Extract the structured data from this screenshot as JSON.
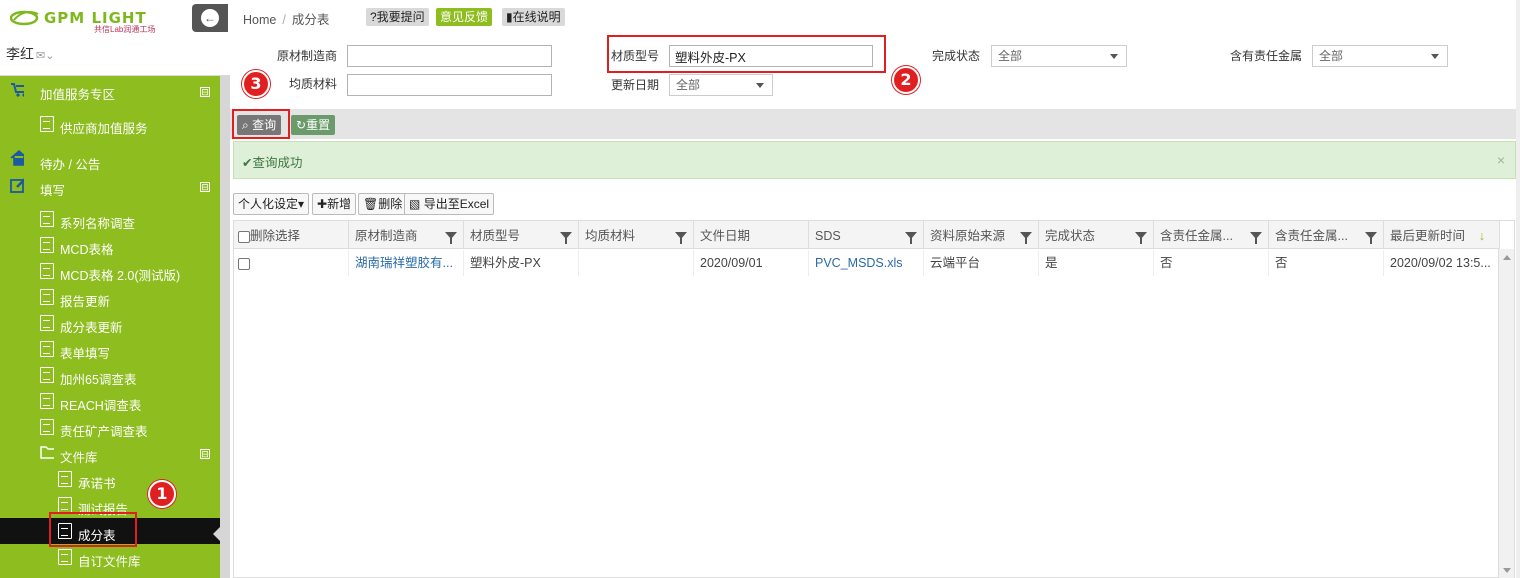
{
  "brand": {
    "logo_text": "GPM LIGHT",
    "logo_sub": "共信Lab润通工场"
  },
  "user": {
    "name": "李红"
  },
  "sidebar": {
    "items": [
      {
        "label": "加值服务专区",
        "toggle": "⊟"
      },
      {
        "label": "供应商加值服务"
      },
      {
        "label": "待办 / 公告"
      },
      {
        "label": "填写",
        "toggle": "⊟"
      },
      {
        "label": "系列名称调查"
      },
      {
        "label": "MCD表格"
      },
      {
        "label": "MCD表格 2.0(测试版)"
      },
      {
        "label": "报告更新"
      },
      {
        "label": "成分表更新"
      },
      {
        "label": "表单填写"
      },
      {
        "label": "加州65调查表"
      },
      {
        "label": "REACH调查表"
      },
      {
        "label": "责任矿产调查表"
      },
      {
        "label": "文件库",
        "toggle": "⊟"
      },
      {
        "label": "承诺书"
      },
      {
        "label": "测试报告"
      },
      {
        "label": "成分表"
      },
      {
        "label": "自订文件库"
      }
    ]
  },
  "breadcrumb": {
    "home": "Home",
    "current": "成分表"
  },
  "top_buttons": {
    "ask": "?我要提问",
    "feedback": "意见反馈",
    "manual": "在线说明"
  },
  "filters": {
    "supplier_label": "原材制造商",
    "homogeneous_label": "均质材料",
    "model_label": "材质型号",
    "model_value": "塑料外皮-PX",
    "update_date_label": "更新日期",
    "update_date_value": "全部",
    "status_label": "完成状态",
    "status_value": "全部",
    "metal_label": "含有责任金属",
    "metal_value": "全部"
  },
  "actions": {
    "query": "查询",
    "reset": "重置"
  },
  "alert": {
    "message": "查询成功",
    "close": "×"
  },
  "grid_toolbar": {
    "personalize": "个人化设定",
    "add": "新增",
    "delete": "删除",
    "export": "导出至Excel"
  },
  "grid": {
    "headers": [
      "删除选择",
      "原材制造商",
      "材质型号",
      "均质材料",
      "文件日期",
      "SDS",
      "资料原始来源",
      "完成状态",
      "含责任金属...",
      "含责任金属...",
      "最后更新时间"
    ],
    "rows": [
      [
        "",
        "湖南瑞祥塑胶有...",
        "塑料外皮-PX",
        "",
        "2020/09/01",
        "PVC_MSDS.xls",
        "云端平台",
        "是",
        "否",
        "否",
        "2020/09/02 13:5..."
      ]
    ]
  },
  "annotations": {
    "one": "1",
    "two": "2",
    "three": "3"
  },
  "colors": {
    "accent": "#8dbd1e",
    "highlight": "#e02020",
    "link": "#2a6aa8"
  }
}
